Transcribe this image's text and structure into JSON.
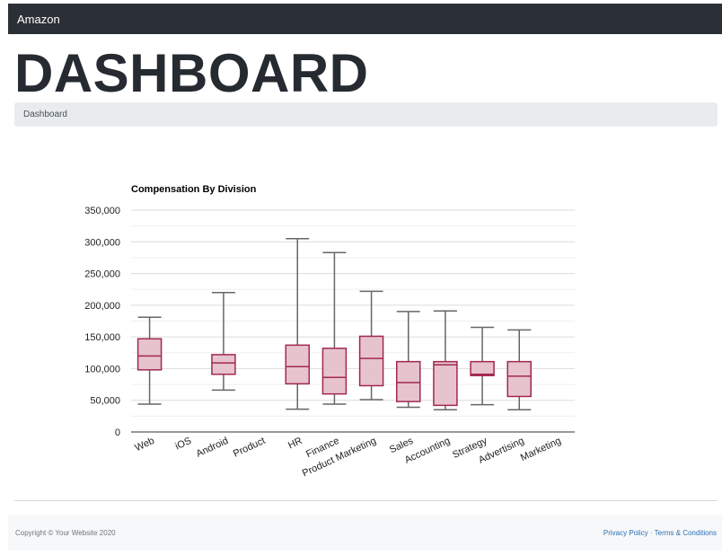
{
  "navbar": {
    "brand": "Amazon"
  },
  "page": {
    "title": "DASHBOARD"
  },
  "breadcrumb": {
    "current": "Dashboard"
  },
  "colors": {
    "box_fill": "#e6c3cd",
    "box_stroke": "#a3284e",
    "whisker": "#666666",
    "grid": "#e4e4e4",
    "navbar_bg": "#2b2f36"
  },
  "chart_data": {
    "type": "boxplot",
    "title": "Compensation By Division",
    "xlabel": "",
    "ylabel": "",
    "ylim": [
      0,
      350000
    ],
    "yticks": [
      0,
      50000,
      100000,
      150000,
      200000,
      250000,
      300000,
      350000
    ],
    "ytick_labels": [
      "0",
      "50,000",
      "100,000",
      "150,000",
      "200,000",
      "250,000",
      "300,000",
      "350,000"
    ],
    "grid": true,
    "categories": [
      "Web",
      "iOS",
      "Android",
      "Product",
      "HR",
      "Finance",
      "Product Marketing",
      "Sales",
      "Accounting",
      "Strategy",
      "Advertising",
      "Marketing"
    ],
    "boxes": [
      {
        "category": "Web",
        "min": 44000,
        "q1": 98000,
        "median": 120000,
        "q3": 147000,
        "max": 181000
      },
      {
        "category": "iOS",
        "min": null,
        "q1": null,
        "median": null,
        "q3": null,
        "max": null
      },
      {
        "category": "Android",
        "min": 66000,
        "q1": 91000,
        "median": 109000,
        "q3": 122000,
        "max": 220000
      },
      {
        "category": "Product",
        "min": null,
        "q1": null,
        "median": null,
        "q3": null,
        "max": null
      },
      {
        "category": "HR",
        "min": 36000,
        "q1": 76000,
        "median": 103000,
        "q3": 137000,
        "max": 305000
      },
      {
        "category": "Finance",
        "min": 44000,
        "q1": 60000,
        "median": 86000,
        "q3": 132000,
        "max": 283000
      },
      {
        "category": "Product Marketing",
        "min": 51000,
        "q1": 73000,
        "median": 116000,
        "q3": 151000,
        "max": 222000
      },
      {
        "category": "Sales",
        "min": 39000,
        "q1": 48000,
        "median": 78000,
        "q3": 111000,
        "max": 190000
      },
      {
        "category": "Accounting",
        "min": 35000,
        "q1": 42000,
        "median": 106000,
        "q3": 111000,
        "max": 191000
      },
      {
        "category": "Strategy",
        "min": 43000,
        "q1": 89000,
        "median": 91000,
        "q3": 111000,
        "max": 165000
      },
      {
        "category": "Advertising",
        "min": 35000,
        "q1": 56000,
        "median": 88000,
        "q3": 111000,
        "max": 161000
      },
      {
        "category": "Marketing",
        "min": null,
        "q1": null,
        "median": null,
        "q3": null,
        "max": null
      }
    ]
  },
  "footer": {
    "copyright": "Copyright © Your Website 2020",
    "privacy": "Privacy Policy",
    "separator": " · ",
    "terms": "Terms & Conditions"
  }
}
